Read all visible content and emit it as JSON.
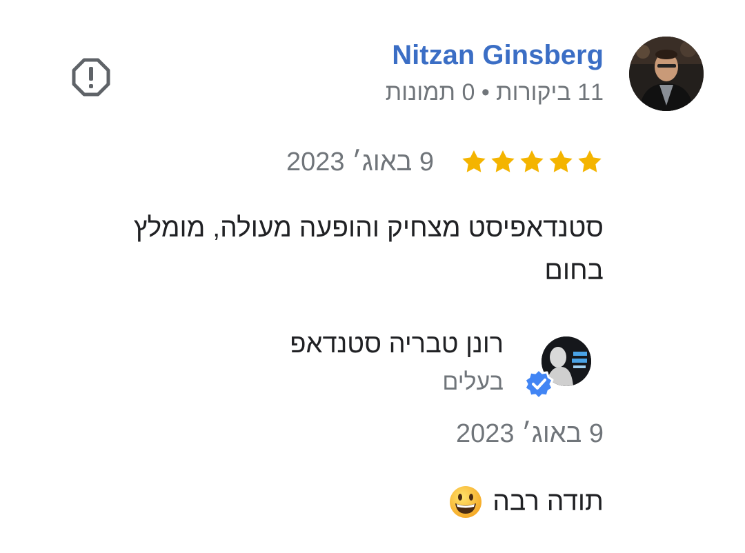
{
  "review": {
    "reviewer_name": "Nitzan Ginsberg",
    "reviewer_meta": "11 ביקורות • 0 תמונות",
    "rating": 5,
    "max_rating": 5,
    "date": "9 באוג׳ 2023",
    "text": "סטנדאפיסט מצחיק והופעה מעולה, מומלץ בחום"
  },
  "reply": {
    "owner_name": "רונן טבריה סטנדאפ",
    "owner_role": "בעלים",
    "date": "9 באוג׳ 2023",
    "text": "תודה רבה",
    "emoji": "grinning-face-emoji"
  },
  "icons": {
    "report": "report-octagon-icon",
    "star": "star-icon",
    "verified": "verified-badge-icon"
  },
  "colors": {
    "name_link": "#3b6ec5",
    "star": "#f4b400",
    "verified": "#4285f4",
    "secondary_text": "#70757a",
    "primary_text": "#202124"
  }
}
